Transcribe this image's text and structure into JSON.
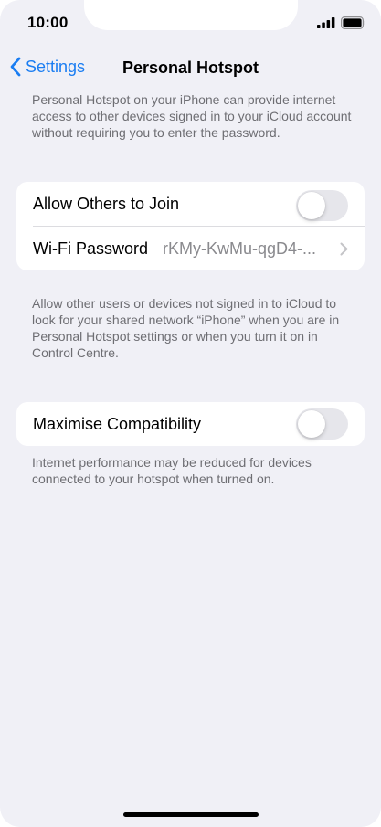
{
  "status_bar": {
    "time": "10:00",
    "signal_icon": "cellular-signal-icon",
    "battery_icon": "battery-full-icon"
  },
  "nav": {
    "back_label": "Settings",
    "title": "Personal Hotspot",
    "accent_color": "#1a7df2"
  },
  "intro_text": "Personal Hotspot on your iPhone can provide internet access to other devices signed in to your iCloud account without requiring you to enter the password.",
  "group_join": {
    "allow_label": "Allow Others to Join",
    "allow_enabled": false,
    "wifi_label": "Wi-Fi Password",
    "wifi_value": "rKMy-KwMu-qgD4-..."
  },
  "join_footer": "Allow other users or devices not signed in to iCloud to look for your shared network “iPhone” when you are in Personal Hotspot settings or when you turn it on in Control Centre.",
  "group_compat": {
    "label": "Maximise Compatibility",
    "enabled": false
  },
  "compat_footer": "Internet performance may be reduced for devices connected to your hotspot when turned on."
}
